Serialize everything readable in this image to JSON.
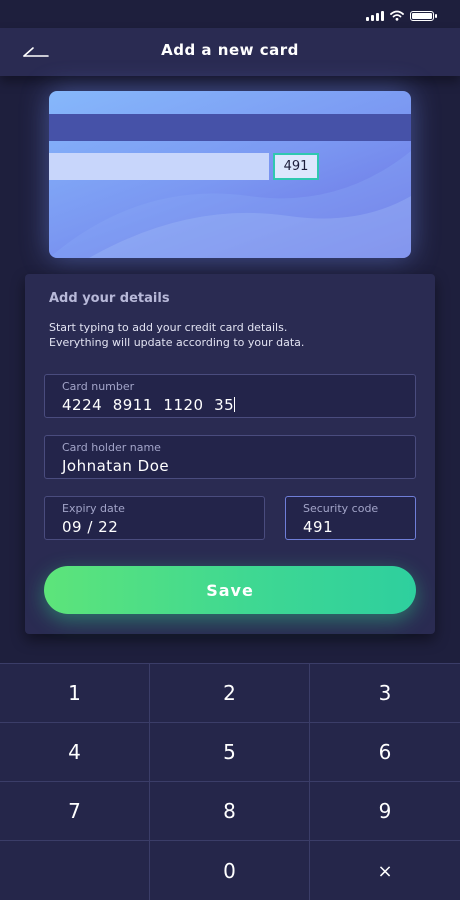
{
  "status_bar": {
    "signal_icon": "signal-icon",
    "wifi_icon": "wifi-icon",
    "battery_icon": "battery-icon"
  },
  "header": {
    "title": "Add a new card",
    "back_icon": "back-arrow-icon"
  },
  "card_preview": {
    "security_code": "491",
    "accent_color": "#2fc8b0"
  },
  "details": {
    "title": "Add your details",
    "description_line1": "Start typing to add your credit card details.",
    "description_line2": "Everything will update according to your data."
  },
  "fields": {
    "card_number": {
      "label": "Card number",
      "value": "4224  8911  1120  35"
    },
    "holder_name": {
      "label": "Card holder name",
      "value": "Johnatan Doe"
    },
    "expiry": {
      "label": "Expiry date",
      "value": "09 / 22"
    },
    "security": {
      "label": "Security code",
      "value": "491"
    }
  },
  "save_button": {
    "label": "Save",
    "color_start": "#5de47a",
    "color_end": "#2ecf9e"
  },
  "keypad": {
    "k1": "1",
    "k2": "2",
    "k3": "3",
    "k4": "4",
    "k5": "5",
    "k6": "6",
    "k7": "7",
    "k8": "8",
    "k9": "9",
    "k0": "0",
    "delete": "×"
  }
}
